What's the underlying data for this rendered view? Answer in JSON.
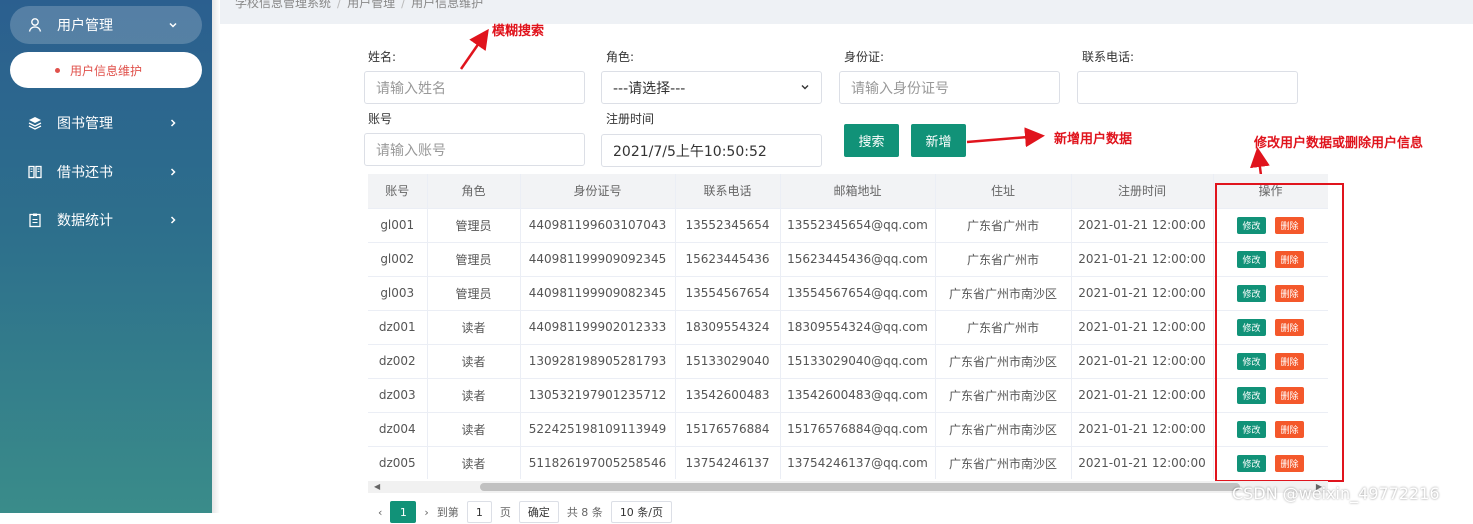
{
  "sidebar": {
    "items": [
      {
        "label": "用户管理",
        "icon": "user-icon",
        "expanded": true
      },
      {
        "label": "图书管理",
        "icon": "layers-icon"
      },
      {
        "label": "借书还书",
        "icon": "book-icon"
      },
      {
        "label": "数据统计",
        "icon": "clipboard-icon"
      }
    ],
    "active_sub": "用户信息维护"
  },
  "breadcrumb": [
    "学校信息管理系统",
    "用户管理",
    "用户信息维护"
  ],
  "form": {
    "name_label": "姓名:",
    "name_placeholder": "请输入姓名",
    "role_label": "角色:",
    "role_selected": "---请选择---",
    "idcard_label": "身份证:",
    "idcard_placeholder": "请输入身份证号",
    "phone_label": "联系电话:",
    "phone_value": "",
    "account_label": "账号",
    "account_placeholder": "请输入账号",
    "regtime_label": "注册时间",
    "regtime_value": "2021/7/5上午10:50:52",
    "search_label": "搜索",
    "add_label": "新增"
  },
  "annotations": {
    "fuzzy_search": "模糊搜索",
    "add_user": "新增用户数据",
    "edit_delete": "修改用户数据或删除用户信息"
  },
  "table": {
    "columns": [
      "账号",
      "角色",
      "身份证号",
      "联系电话",
      "邮箱地址",
      "住址",
      "注册时间",
      "操作"
    ],
    "edit_label": "修改",
    "delete_label": "删除",
    "rows": [
      [
        "gl001",
        "管理员",
        "440981199603107043",
        "13552345654",
        "13552345654@qq.com",
        "广东省广州市",
        "2021-01-21 12:00:00"
      ],
      [
        "gl002",
        "管理员",
        "440981199909092345",
        "15623445436",
        "15623445436@qq.com",
        "广东省广州市",
        "2021-01-21 12:00:00"
      ],
      [
        "gl003",
        "管理员",
        "440981199909082345",
        "13554567654",
        "13554567654@qq.com",
        "广东省广州市南沙区",
        "2021-01-21 12:00:00"
      ],
      [
        "dz001",
        "读者",
        "440981199902012333",
        "18309554324",
        "18309554324@qq.com",
        "广东省广州市",
        "2021-01-21 12:00:00"
      ],
      [
        "dz002",
        "读者",
        "130928198905281793",
        "15133029040",
        "15133029040@qq.com",
        "广东省广州市南沙区",
        "2021-01-21 12:00:00"
      ],
      [
        "dz003",
        "读者",
        "130532197901235712",
        "13542600483",
        "13542600483@qq.com",
        "广东省广州市南沙区",
        "2021-01-21 12:00:00"
      ],
      [
        "dz004",
        "读者",
        "522425198109113949",
        "15176576884",
        "15176576884@qq.com",
        "广东省广州市南沙区",
        "2021-01-21 12:00:00"
      ],
      [
        "dz005",
        "读者",
        "511826197005258546",
        "13754246137",
        "13754246137@qq.com",
        "广东省广州市南沙区",
        "2021-01-21 12:00:00"
      ]
    ]
  },
  "pager": {
    "current": "1",
    "goto_label": "到第",
    "page_input": "1",
    "page_unit": "页",
    "confirm_label": "确定",
    "total": "共 8 条",
    "page_size": "10 条/页"
  },
  "watermark": "CSDN @weixin_49772216",
  "colors": {
    "accent": "#119278",
    "danger": "#f4582b",
    "annotation": "#e0141d"
  }
}
